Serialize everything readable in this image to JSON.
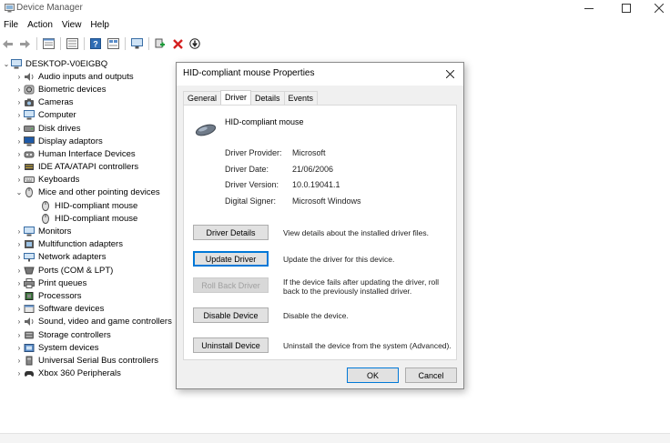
{
  "window": {
    "title": "Device Manager",
    "controls": {
      "minimize": "—",
      "maximize": "☐",
      "close": "✕"
    }
  },
  "menu": [
    "File",
    "Action",
    "View",
    "Help"
  ],
  "toolbar": [
    "back-icon",
    "forward-icon",
    "properties-icon",
    "list-icon",
    "help-icon",
    "view-icon",
    "monitor-icon",
    "add-driver-icon",
    "uninstall-icon",
    "update-icon"
  ],
  "tree": {
    "root": "DESKTOP-V0EIGBQ",
    "items": [
      {
        "label": "Audio inputs and outputs",
        "expanded": false,
        "icon": "audio-icon"
      },
      {
        "label": "Biometric devices",
        "expanded": false,
        "icon": "biometric-icon"
      },
      {
        "label": "Cameras",
        "expanded": false,
        "icon": "camera-icon"
      },
      {
        "label": "Computer",
        "expanded": false,
        "icon": "computer-icon"
      },
      {
        "label": "Disk drives",
        "expanded": false,
        "icon": "disk-icon"
      },
      {
        "label": "Display adaptors",
        "expanded": false,
        "icon": "display-icon"
      },
      {
        "label": "Human Interface Devices",
        "expanded": false,
        "icon": "hid-icon"
      },
      {
        "label": "IDE ATA/ATAPI controllers",
        "expanded": false,
        "icon": "ide-icon"
      },
      {
        "label": "Keyboards",
        "expanded": false,
        "icon": "keyboard-icon"
      },
      {
        "label": "Mice and other pointing devices",
        "expanded": true,
        "icon": "mouse-icon"
      },
      {
        "label": "HID-compliant mouse",
        "child": true,
        "icon": "mouse-icon"
      },
      {
        "label": "HID-compliant mouse",
        "child": true,
        "icon": "mouse-icon"
      },
      {
        "label": "Monitors",
        "expanded": false,
        "icon": "monitor-icon"
      },
      {
        "label": "Multifunction adapters",
        "expanded": false,
        "icon": "multifunction-icon"
      },
      {
        "label": "Network adapters",
        "expanded": false,
        "icon": "network-icon"
      },
      {
        "label": "Ports (COM & LPT)",
        "expanded": false,
        "icon": "port-icon"
      },
      {
        "label": "Print queues",
        "expanded": false,
        "icon": "printer-icon"
      },
      {
        "label": "Processors",
        "expanded": false,
        "icon": "processor-icon"
      },
      {
        "label": "Software devices",
        "expanded": false,
        "icon": "software-icon"
      },
      {
        "label": "Sound, video and game controllers",
        "expanded": false,
        "icon": "sound-icon"
      },
      {
        "label": "Storage controllers",
        "expanded": false,
        "icon": "storage-icon"
      },
      {
        "label": "System devices",
        "expanded": false,
        "icon": "system-icon"
      },
      {
        "label": "Universal Serial Bus controllers",
        "expanded": false,
        "icon": "usb-icon"
      },
      {
        "label": "Xbox 360 Peripherals",
        "expanded": false,
        "icon": "gamepad-icon"
      }
    ]
  },
  "dialog": {
    "title": "HID-compliant mouse Properties",
    "tabs": [
      "General",
      "Driver",
      "Details",
      "Events"
    ],
    "active_tab": "Driver",
    "device_name": "HID-compliant mouse",
    "properties": [
      {
        "label": "Driver Provider:",
        "value": "Microsoft"
      },
      {
        "label": "Driver Date:",
        "value": "21/06/2006"
      },
      {
        "label": "Driver Version:",
        "value": "10.0.19041.1"
      },
      {
        "label": "Digital Signer:",
        "value": "Microsoft Windows"
      }
    ],
    "actions": [
      {
        "label": "Driver Details",
        "desc": "View details about the installed driver files."
      },
      {
        "label": "Update Driver",
        "desc": "Update the driver for this device."
      },
      {
        "label": "Roll Back Driver",
        "desc": "If the device fails after updating the driver, roll back to the previously installed driver."
      },
      {
        "label": "Disable Device",
        "desc": "Disable the device."
      },
      {
        "label": "Uninstall Device",
        "desc": "Uninstall the device from the system (Advanced)."
      }
    ],
    "ok": "OK",
    "cancel": "Cancel"
  }
}
